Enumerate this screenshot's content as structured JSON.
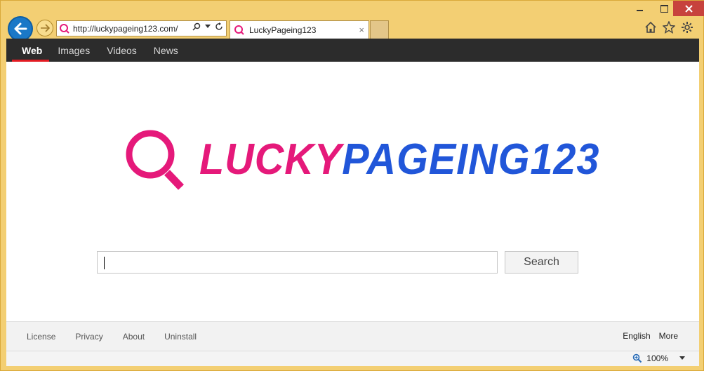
{
  "browser": {
    "address_url": "http://luckypageing123.com/",
    "tab_title": "LuckyPageing123",
    "tab_close": "×"
  },
  "nav": {
    "items": [
      "Web",
      "Images",
      "Videos",
      "News"
    ]
  },
  "logo": {
    "part1": "LUCKY",
    "part2": "PAGEING123"
  },
  "search": {
    "button_label": "Search",
    "input_value": ""
  },
  "footer": {
    "links": [
      "License",
      "Privacy",
      "About",
      "Uninstall"
    ],
    "language": "English",
    "more": "More"
  },
  "status": {
    "zoom": "100%"
  },
  "colors": {
    "lucky": "#e5197a",
    "pageing": "#2156d9",
    "nav_bg": "#2c2c2c",
    "active_underline": "#e31b23"
  }
}
